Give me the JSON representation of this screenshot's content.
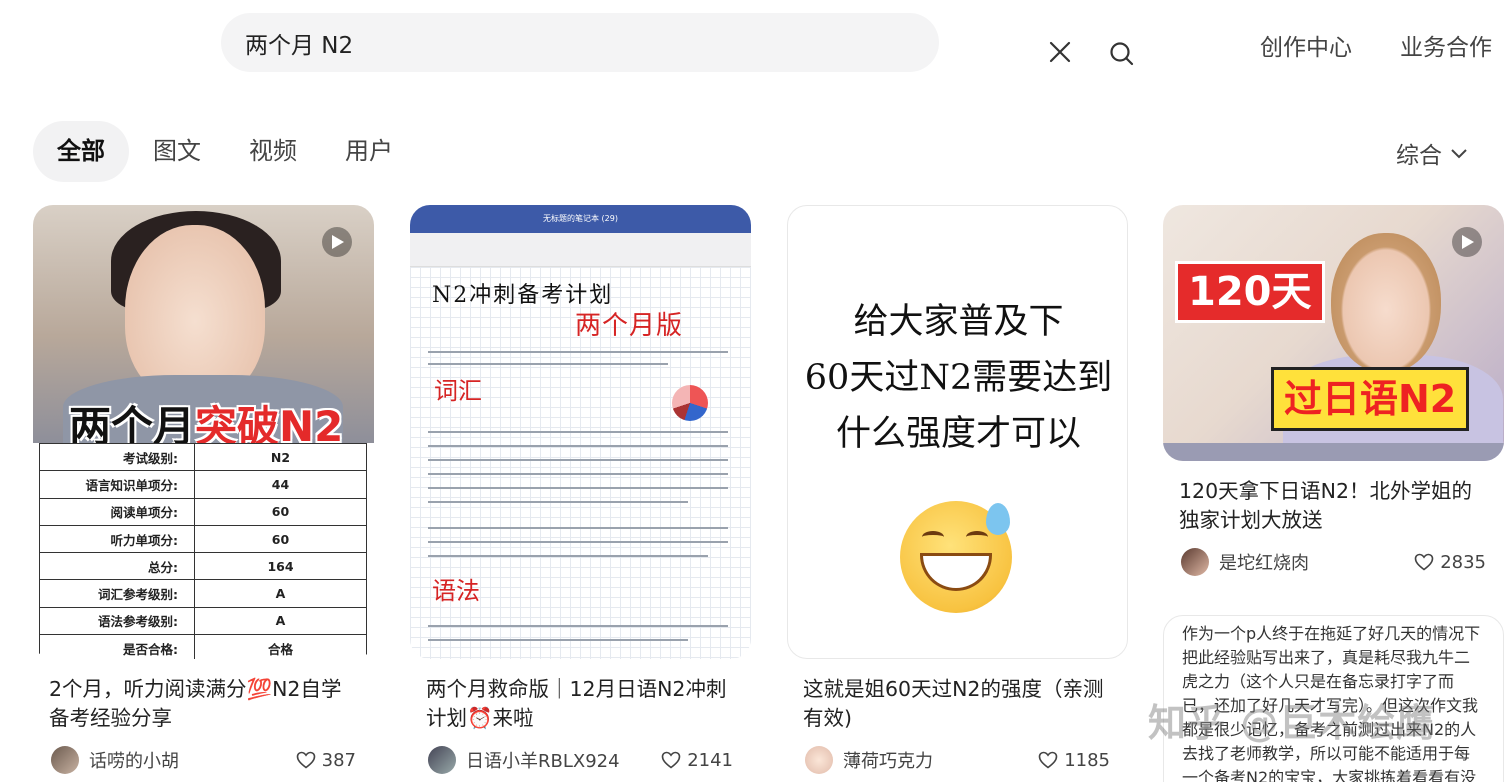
{
  "search": {
    "value": "两个月 N2",
    "placeholder": ""
  },
  "header": {
    "links": [
      "创作中心",
      "业务合作"
    ]
  },
  "tabs": [
    {
      "label": "全部",
      "active": true
    },
    {
      "label": "图文",
      "active": false
    },
    {
      "label": "视频",
      "active": false
    },
    {
      "label": "用户",
      "active": false
    }
  ],
  "sort": {
    "label": "综合"
  },
  "cards": [
    {
      "title": "2个月，听力阅读满分💯N2自学备考经验分享",
      "author": "话唠的小胡",
      "likes": "387",
      "image": {
        "overlay_text_black": "两个月",
        "overlay_text_red": "突破N2",
        "is_video": true,
        "table": [
          [
            "考试级别:",
            "N2"
          ],
          [
            "语言知识单项分:",
            "44"
          ],
          [
            "阅读单项分:",
            "60"
          ],
          [
            "听力单项分:",
            "60"
          ],
          [
            "总分:",
            "164"
          ],
          [
            "词汇参考级别:",
            "A"
          ],
          [
            "语法参考级别:",
            "A"
          ],
          [
            "是否合格:",
            "合格"
          ]
        ]
      }
    },
    {
      "title": "两个月救命版｜12月日语N2冲刺计划⏰来啦",
      "author": "日语小羊RBLX924",
      "likes": "2141",
      "image": {
        "toolbar_title": "无标题的笔记本 (29)",
        "heading": "N2冲刺备考计划",
        "subheading": "两个月版",
        "section1": "词汇",
        "section2": "语法"
      }
    },
    {
      "title": "这就是姐60天过N2的强度（亲测有效)",
      "author": "薄荷巧克力",
      "likes": "1185",
      "image": {
        "lines": [
          "给大家普及下",
          "60天过N2需要达到",
          "什么强度才可以"
        ]
      }
    },
    {
      "title": "120天拿下日语N2！北外学姐的独家计划大放送",
      "author": "是坨红烧肉",
      "likes": "2835",
      "image": {
        "label1": "120天",
        "label2": "过日语N2",
        "is_video": true
      }
    }
  ],
  "card5": {
    "text": "作为一个p人终于在拖延了好几天的情况下把此经验贴写出来了，真是耗尽我九牛二虎之力（这个人只是在备忘录打字了而已，还加了好几天才写完）。但这次作文我都是很少记忆，备考之前测过出来N2的人去找了老师教学，所以可能不能适用于每一个备考N2的宝宝，大家挑拣着看看有没有适合自"
  },
  "watermark": "知乎 @巨木绘鹰",
  "colors": {
    "accent_red": "#e42a2a",
    "tab_active_bg": "#f2f2f3",
    "search_bg": "#f4f4f5"
  },
  "icons": [
    "close-icon",
    "search-icon",
    "chevron-down-icon",
    "heart-icon",
    "play-icon"
  ]
}
